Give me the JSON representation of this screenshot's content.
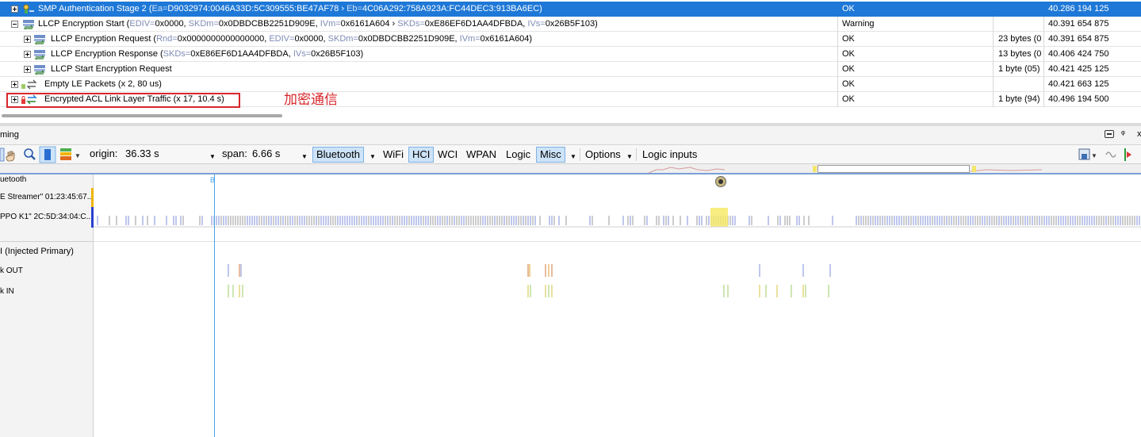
{
  "packets": [
    {
      "expander": "plus",
      "icon": "smp-icon",
      "selected": true,
      "parts": [
        {
          "t": "SMP Authentication Stage 2 ("
        },
        {
          "t": "Ea=",
          "f": true
        },
        {
          "t": "D9032974:0046A33D:5C309555:BE47AF78 › "
        },
        {
          "t": "Eb=",
          "f": true
        },
        {
          "t": "4C06A292:758A923A:FC44DEC3:913BA6EC)"
        }
      ],
      "status": "OK",
      "length": "",
      "time": "40.286 194 125"
    },
    {
      "expander": "minus",
      "icon": "llcp-icon",
      "selected": false,
      "parts": [
        {
          "t": "LLCP Encryption Start ("
        },
        {
          "t": "EDIV=",
          "f": true
        },
        {
          "t": "0x0000, "
        },
        {
          "t": "SKDm=",
          "f": true
        },
        {
          "t": "0x0DBDCBB2251D909E, "
        },
        {
          "t": "IVm=",
          "f": true
        },
        {
          "t": "0x6161A604 › "
        },
        {
          "t": "SKDs=",
          "f": true
        },
        {
          "t": "0xE86EF6D1AA4DFBDA, "
        },
        {
          "t": "IVs=",
          "f": true
        },
        {
          "t": "0x26B5F103)"
        }
      ],
      "status": "Warning",
      "length": "",
      "time": "40.391 654 875"
    },
    {
      "expander": "plus",
      "icon": "llcp-icon",
      "selected": false,
      "parts": [
        {
          "t": "LLCP Encryption Request ("
        },
        {
          "t": "Rnd=",
          "f": true
        },
        {
          "t": "0x0000000000000000, "
        },
        {
          "t": "EDIV=",
          "f": true
        },
        {
          "t": "0x0000, "
        },
        {
          "t": "SKDm=",
          "f": true
        },
        {
          "t": "0x0DBDCBB2251D909E, "
        },
        {
          "t": "IVm=",
          "f": true
        },
        {
          "t": "0x6161A604)"
        }
      ],
      "status": "OK",
      "length": "23 bytes (0",
      "time": "40.391 654 875"
    },
    {
      "expander": "plus",
      "icon": "llcp-icon",
      "selected": false,
      "parts": [
        {
          "t": "LLCP Encryption Response ("
        },
        {
          "t": "SKDs=",
          "f": true
        },
        {
          "t": "0xE86EF6D1AA4DFBDA, "
        },
        {
          "t": "IVs=",
          "f": true
        },
        {
          "t": "0x26B5F103)"
        }
      ],
      "status": "OK",
      "length": "13 bytes (0",
      "time": "40.406 424 750"
    },
    {
      "expander": "plus",
      "icon": "llcp-icon",
      "selected": false,
      "parts": [
        {
          "t": "LLCP Start Encryption Request"
        }
      ],
      "status": "OK",
      "length": "1 byte (05)",
      "time": "40.421 425 125"
    },
    {
      "expander": "plus",
      "icon": "empty-packets-icon",
      "selected": false,
      "parts": [
        {
          "t": "Empty LE Packets (x 2, 80 us)"
        }
      ],
      "status": "OK",
      "length": "",
      "time": "40.421 663 125"
    },
    {
      "expander": "plus",
      "icon": "encrypted-traffic-icon",
      "selected": false,
      "parts": [
        {
          "t": "Encrypted ACL Link Layer Traffic  (x 17, 10.4 s)"
        }
      ],
      "status": "OK",
      "length": "1 byte (94)",
      "time": "40.496 194 500"
    }
  ],
  "annotation": "加密通信",
  "panel": {
    "title": "ming",
    "dock": "ᵠ",
    "close": "x"
  },
  "toolbar": {
    "origin_label": "origin:",
    "origin_value": "36.33 s",
    "span_label": "span:",
    "span_value": "6.66 s",
    "bluetooth": "Bluetooth",
    "wifi": "WiFi",
    "hci": "HCI",
    "wci": "WCI",
    "wpan": "WPAN",
    "logic": "Logic",
    "misc": "Misc",
    "options": "Options",
    "logic_inputs": "Logic inputs"
  },
  "timeline": {
    "cursor_label": "B",
    "labels": {
      "bluetooth": "uetooth",
      "device1": "E Streamer\" 01:23:45:67...",
      "device2": "PPO K1\" 2C:5D:34:04:C...",
      "hci": "I (Injected Primary)",
      "bulk_out": "k OUT",
      "bulk_in": "k IN"
    }
  },
  "colors": {
    "selected_row": "#1e78d7",
    "annotation": "#d8262b",
    "field": "#7d8bb5",
    "cursor": "#4aa3e8"
  }
}
